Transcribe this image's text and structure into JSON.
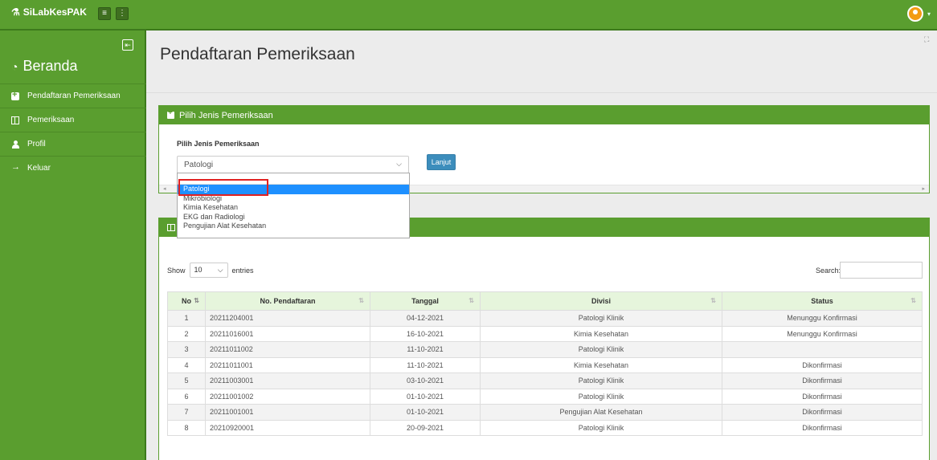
{
  "app": {
    "brand": "SiLabKesPAK"
  },
  "sidebar": {
    "title": "Beranda",
    "items": [
      {
        "label": "Pendaftaran Pemeriksaan",
        "icon": "plus-square-icon"
      },
      {
        "label": "Pemeriksaan",
        "icon": "table-icon"
      },
      {
        "label": "Profil",
        "icon": "user-icon"
      },
      {
        "label": "Keluar",
        "icon": "sign-out-icon"
      }
    ]
  },
  "page": {
    "title": "Pendaftaran Pemeriksaan"
  },
  "select_panel": {
    "header": "Pilih Jenis Pemeriksaan",
    "label": "Pilih Jenis Pemeriksaan",
    "selected": "Patologi",
    "button": "Lanjut",
    "options": [
      "Patologi",
      "Mikrobiologi",
      "Kimia Kesehatan",
      "EKG dan Radiologi",
      "Pengujian Alat Kesehatan"
    ]
  },
  "table_panel": {
    "show_label": "Show",
    "entries_value": "10",
    "entries_label": "entries",
    "search_label": "Search:",
    "columns": [
      "No",
      "No. Pendaftaran",
      "Tanggal",
      "Divisi",
      "Status"
    ],
    "rows": [
      [
        "1",
        "20211204001",
        "04-12-2021",
        "Patologi Klinik",
        "Menunggu Konfirmasi"
      ],
      [
        "2",
        "20211016001",
        "16-10-2021",
        "Kimia Kesehatan",
        "Menunggu Konfirmasi"
      ],
      [
        "3",
        "20211011002",
        "11-10-2021",
        "Patologi Klinik",
        ""
      ],
      [
        "4",
        "20211011001",
        "11-10-2021",
        "Kimia Kesehatan",
        "Dikonfirmasi"
      ],
      [
        "5",
        "20211003001",
        "03-10-2021",
        "Patologi Klinik",
        "Dikonfirmasi"
      ],
      [
        "6",
        "20211001002",
        "01-10-2021",
        "Patologi Klinik",
        "Dikonfirmasi"
      ],
      [
        "7",
        "20211001001",
        "01-10-2021",
        "Pengujian Alat Kesehatan",
        "Dikonfirmasi"
      ],
      [
        "8",
        "20210920001",
        "20-09-2021",
        "Patologi Klinik",
        "Dikonfirmasi"
      ]
    ]
  }
}
